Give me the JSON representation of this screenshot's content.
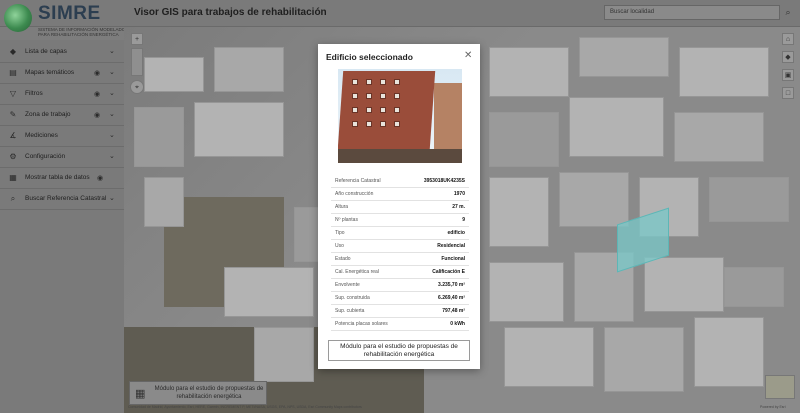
{
  "header": {
    "logo_title": "SIMRE",
    "logo_subtitle": "SISTEMA DE INFORMACIÓN MODELADO PARA REHABILITACIÓN ENERGÉTICA",
    "app_title": "Visor GIS para trabajos de rehabilitación",
    "search_placeholder": "Buscar localidad"
  },
  "sidebar": {
    "items": [
      {
        "label": "Lista de capas",
        "icon": "layers-icon",
        "eye": false
      },
      {
        "label": "Mapas temáticos",
        "icon": "map-icon",
        "eye": true
      },
      {
        "label": "Filtros",
        "icon": "filter-icon",
        "eye": true
      },
      {
        "label": "Zona de trabajo",
        "icon": "pencil-icon",
        "eye": true
      },
      {
        "label": "Mediciones",
        "icon": "ruler-icon",
        "eye": false
      },
      {
        "label": "Configuración",
        "icon": "gear-icon",
        "eye": false
      },
      {
        "label": "Mostrar tabla de datos",
        "icon": "table-icon",
        "eye": true
      },
      {
        "label": "Buscar Referencia Catastral",
        "icon": "search-icon",
        "eye": false
      }
    ]
  },
  "modal": {
    "title": "Edificio seleccionado",
    "rows": [
      {
        "key": "Referencia Catastral",
        "value": "3953018UK4235S"
      },
      {
        "key": "Año construcción",
        "value": "1970"
      },
      {
        "key": "Altura",
        "value": "27 m."
      },
      {
        "key": "Nº plantas",
        "value": "9"
      },
      {
        "key": "Tipo",
        "value": "edificio"
      },
      {
        "key": "Uso",
        "value": "Residencial"
      },
      {
        "key": "Estado",
        "value": "Funcional"
      },
      {
        "key": "Cal. Energética real",
        "value": "Calificación E"
      },
      {
        "key": "Envolvente",
        "value": "3.235,70 m²"
      },
      {
        "key": "Sup. construida",
        "value": "6.269,40 m²"
      },
      {
        "key": "Sup. cubierta",
        "value": "797,48 m²"
      },
      {
        "key": "Potencia placas solares",
        "value": "0 kWh"
      }
    ],
    "module_button": "Módulo para el estudio de propuestas de rehabilitación energética"
  },
  "bottom_module": {
    "label": "Módulo para el estudio de propuestas de rehabilitación energética"
  },
  "attribution": "Comunidad de Madrid, Ayuntamiento, Esri, HERE, Garmin, INCREMENT P, METI/NASA, USGS, EPA, NPS, USDA, Esri Community Maps contributors",
  "powered": "Powered by Esri"
}
